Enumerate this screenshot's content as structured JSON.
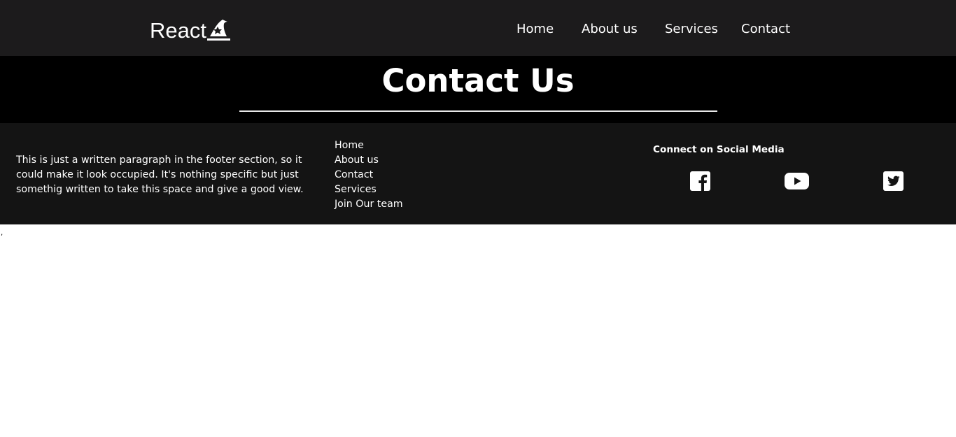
{
  "navbar": {
    "brand_text": "React",
    "links": [
      {
        "label": "Home"
      },
      {
        "label": "About us"
      },
      {
        "label": "Services"
      },
      {
        "label": "Contact"
      }
    ],
    "background": "#1c1b1c"
  },
  "hero": {
    "title": "Contact Us",
    "background": "#000000"
  },
  "footer": {
    "paragraph": "This is just a written paragraph in the footer section, so it could make it look occupied. It's nothing specific but just somethig written to take this space and give a good view.",
    "links": [
      {
        "label": "Home"
      },
      {
        "label": "About us"
      },
      {
        "label": "Contact"
      },
      {
        "label": "Services"
      },
      {
        "label": "Join Our team"
      }
    ],
    "social_heading": "Connect on Social Media",
    "social_icons": [
      "facebook-icon",
      "youtube-icon",
      "twitter-icon"
    ],
    "background": "#141414"
  },
  "stray_text": ","
}
